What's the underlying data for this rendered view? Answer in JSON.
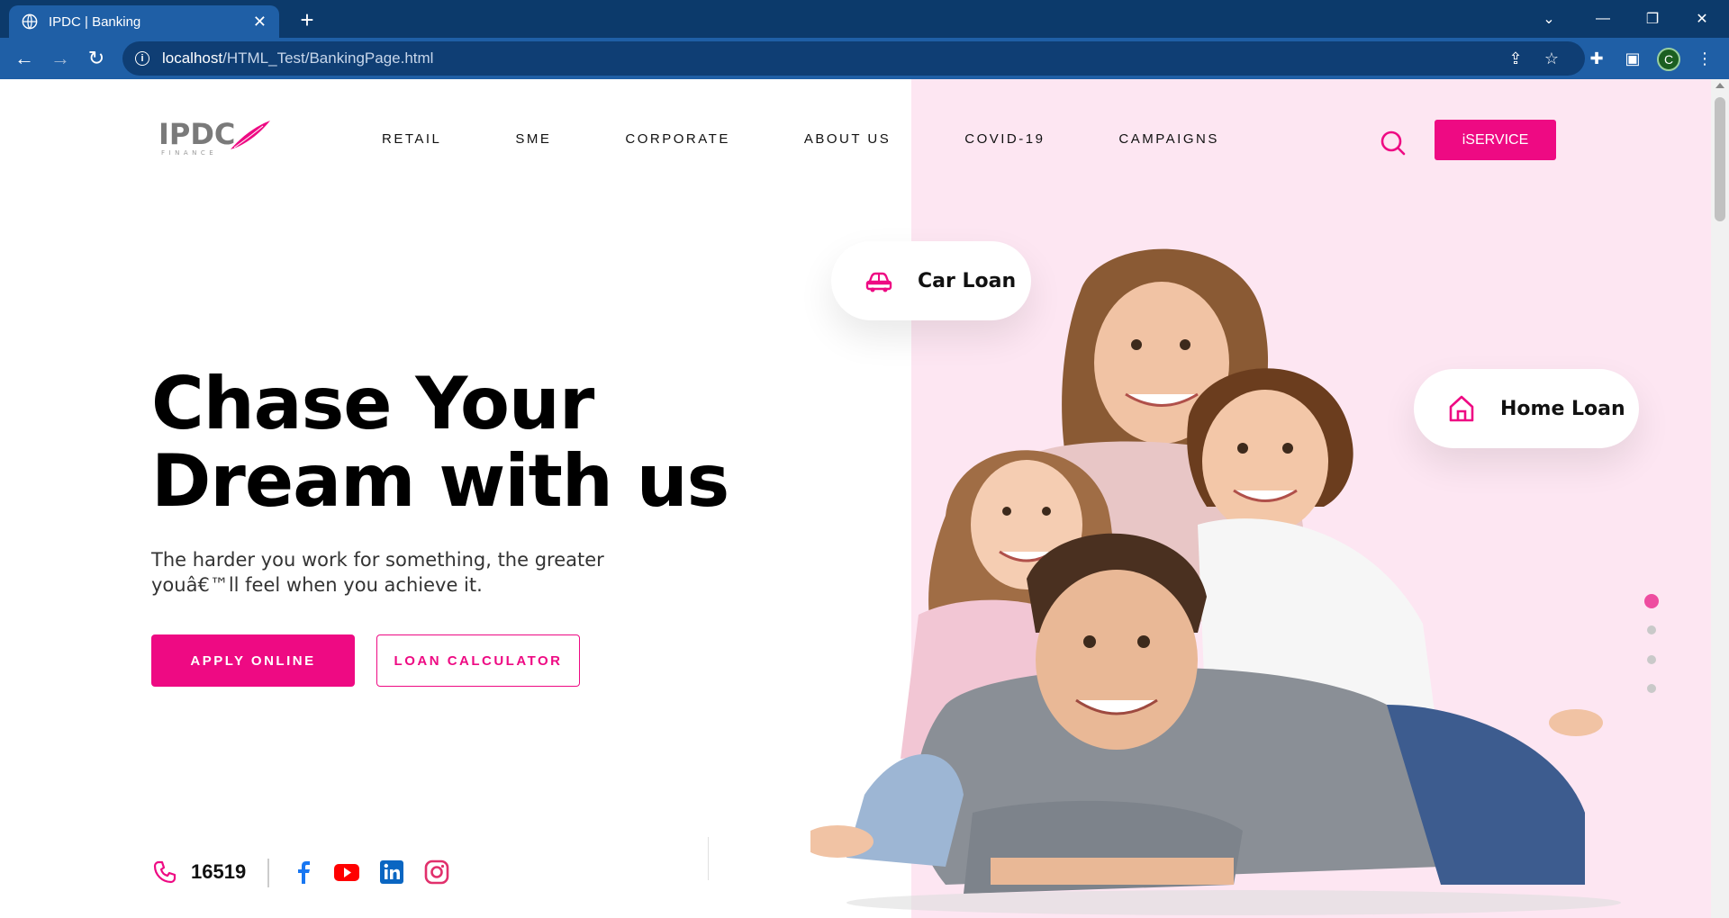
{
  "browser": {
    "tab_title": "IPDC | Banking",
    "url_host": "localhost",
    "url_path": "/HTML_Test/BankingPage.html",
    "profile_initial": "C"
  },
  "header": {
    "logo_text": "IPDC",
    "logo_subtext": "FINANCE",
    "nav": [
      "RETAIL",
      "SME",
      "CORPORATE",
      "ABOUT US",
      "COVID-19",
      "CAMPAIGNS"
    ],
    "iservice_label": "iSERVICE"
  },
  "hero": {
    "title_line1": "Chase Your",
    "title_line2": "Dream with us",
    "subtitle_line1": "The harder you work for something, the greater",
    "subtitle_line2": "youâ€™ll feel when you achieve it.",
    "apply_label": "APPLY ONLINE",
    "calc_label": "LOAN CALCULATOR"
  },
  "cards": {
    "car_loan": "Car Loan",
    "home_loan": "Home Loan"
  },
  "slider": {
    "count": 4,
    "active": 0
  },
  "contact": {
    "phone": "16519"
  },
  "social": [
    "facebook-icon",
    "youtube-icon",
    "linkedin-icon",
    "instagram-icon"
  ],
  "colors": {
    "accent": "#ee0a83",
    "pink_bg": "#fde6f2",
    "chrome_dark": "#0c3a6b",
    "chrome": "#1f5fa6"
  }
}
